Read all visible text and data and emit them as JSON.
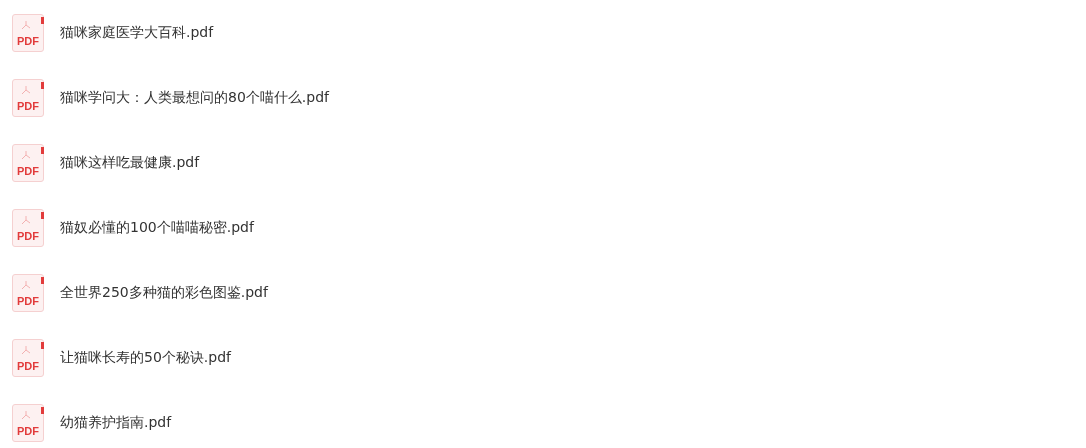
{
  "files": [
    {
      "icon_label": "PDF",
      "name": "猫咪家庭医学大百科.pdf"
    },
    {
      "icon_label": "PDF",
      "name": "猫咪学问大：人类最想问的80个喵什么.pdf"
    },
    {
      "icon_label": "PDF",
      "name": "猫咪这样吃最健康.pdf"
    },
    {
      "icon_label": "PDF",
      "name": "猫奴必懂的100个喵喵秘密.pdf"
    },
    {
      "icon_label": "PDF",
      "name": "全世界250多种猫的彩色图鉴.pdf"
    },
    {
      "icon_label": "PDF",
      "name": "让猫咪长寿的50个秘诀.pdf"
    },
    {
      "icon_label": "PDF",
      "name": "幼猫养护指南.pdf"
    }
  ]
}
